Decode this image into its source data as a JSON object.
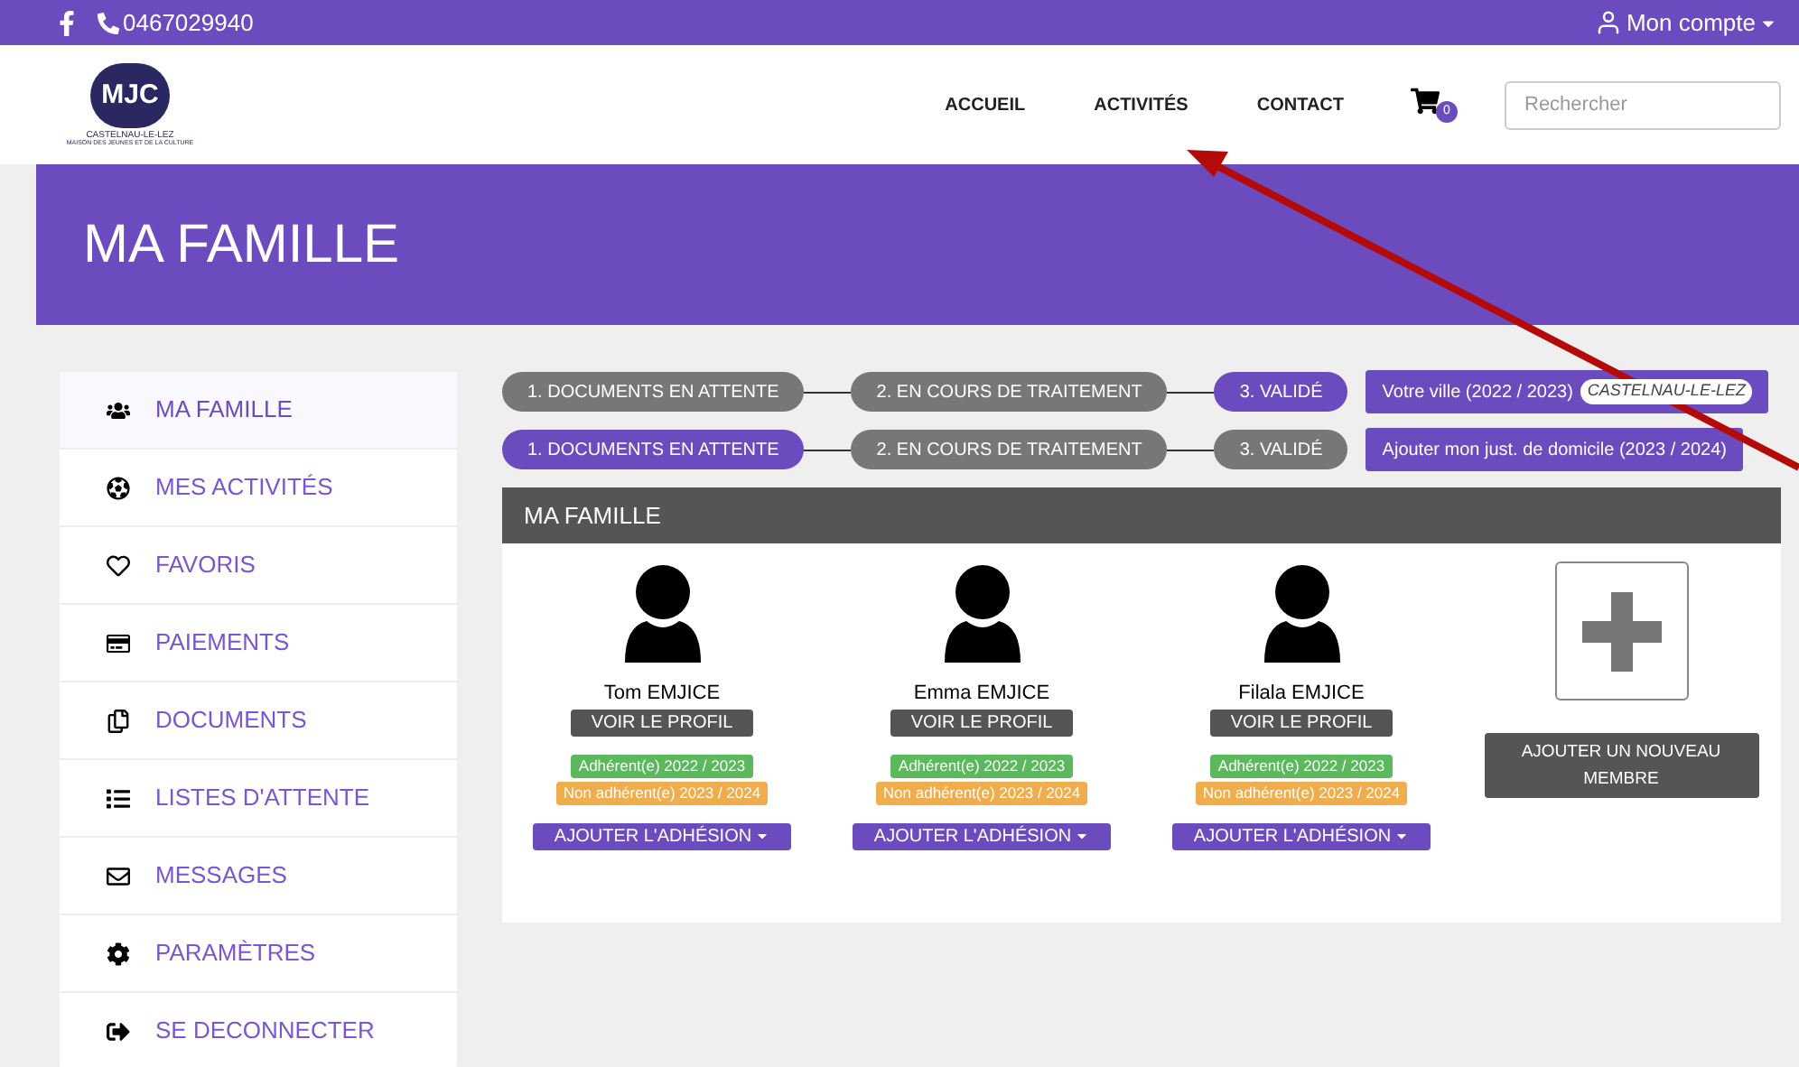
{
  "topbar": {
    "phone": "0467029940",
    "account": "Mon compte"
  },
  "logo": {
    "letters": "MJC",
    "town": "CASTELNAU-LE-LEZ",
    "subtitle": "MAISON DES JEUNES ET DE LA CULTURE"
  },
  "nav": [
    {
      "label": "ACCUEIL",
      "selected": false
    },
    {
      "label": "ACTIVITÉS",
      "selected": false
    },
    {
      "label": "CONTACT",
      "selected": false
    }
  ],
  "cart": {
    "count": "0"
  },
  "search": {
    "placeholder": "Rechercher"
  },
  "banner": {
    "title": "MA FAMILLE"
  },
  "sidebar": {
    "items": [
      {
        "label": "MA FAMILLE",
        "selected": true
      },
      {
        "label": "MES ACTIVITÉS",
        "selected": false
      },
      {
        "label": "FAVORIS",
        "selected": false
      },
      {
        "label": "PAIEMENTS",
        "selected": false
      },
      {
        "label": "DOCUMENTS",
        "selected": false
      },
      {
        "label": "LISTES D'ATTENTE",
        "selected": false
      },
      {
        "label": "MESSAGES",
        "selected": false
      },
      {
        "label": "PARAMÈTRES",
        "selected": false
      },
      {
        "label": "SE DECONNECTER",
        "selected": false
      }
    ]
  },
  "status_rows": [
    {
      "steps": [
        {
          "label": "1. DOCUMENTS EN ATTENTE",
          "selected": false
        },
        {
          "label": "2. EN COURS DE TRAITEMENT",
          "selected": false
        },
        {
          "label": "3. VALIDÉ",
          "selected": true
        }
      ],
      "action": "Votre ville (2022 / 2023)",
      "tag": "CASTELNAU-LE-LEZ"
    },
    {
      "steps": [
        {
          "label": "1. DOCUMENTS EN ATTENTE",
          "selected": true
        },
        {
          "label": "2. EN COURS DE TRAITEMENT",
          "selected": false
        },
        {
          "label": "3. VALIDÉ",
          "selected": false
        }
      ],
      "action": "Ajouter mon just. de domicile (2023 / 2024)"
    }
  ],
  "family_panel": {
    "title": "MA FAMILLE",
    "members": [
      {
        "name": "Tom EMJICE",
        "profile_button": "VOIR LE PROFIL",
        "badges": [
          {
            "label": "Adhérent(e) 2022 / 2023",
            "color": "#5cb85c"
          },
          {
            "label": "Non adhérent(e) 2023 / 2024",
            "color": "#f0ad4e"
          }
        ],
        "membership_button": "AJOUTER L'ADHÉSION"
      },
      {
        "name": "Emma EMJICE",
        "profile_button": "VOIR LE PROFIL",
        "badges": [
          {
            "label": "Adhérent(e) 2022 / 2023",
            "color": "#5cb85c"
          },
          {
            "label": "Non adhérent(e) 2023 / 2024",
            "color": "#f0ad4e"
          }
        ],
        "membership_button": "AJOUTER L'ADHÉSION"
      },
      {
        "name": "Filala EMJICE",
        "profile_button": "VOIR LE PROFIL",
        "badges": [
          {
            "label": "Adhérent(e) 2022 / 2023",
            "color": "#5cb85c"
          },
          {
            "label": "Non adhérent(e) 2023 / 2024",
            "color": "#f0ad4e"
          }
        ],
        "membership_button": "AJOUTER L'ADHÉSION"
      }
    ],
    "add_member_button": "AJOUTER UN NOUVEAU MEMBRE"
  }
}
